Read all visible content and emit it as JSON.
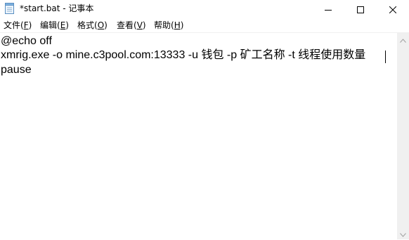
{
  "window": {
    "title": "*start.bat - 记事本"
  },
  "menu": {
    "file": {
      "text": "文件(",
      "key": "F",
      "close": ")"
    },
    "edit": {
      "text": "编辑(",
      "key": "E",
      "close": ")"
    },
    "format": {
      "text": "格式(",
      "key": "O",
      "close": ")"
    },
    "view": {
      "text": "查看(",
      "key": "V",
      "close": ")"
    },
    "help": {
      "text": "帮助(",
      "key": "H",
      "close": ")"
    }
  },
  "editor": {
    "lines": [
      "@echo off",
      "xmrig.exe -o mine.c3pool.com:13333 -u 钱包 -p 矿工名称 -t 线程使用数量",
      "pause"
    ]
  },
  "icons": {
    "app": "notepad-icon",
    "minimize": "minimize-icon",
    "maximize": "maximize-icon",
    "close": "close-icon",
    "scroll_up": "chevron-up-icon",
    "scroll_down": "chevron-down-icon"
  }
}
